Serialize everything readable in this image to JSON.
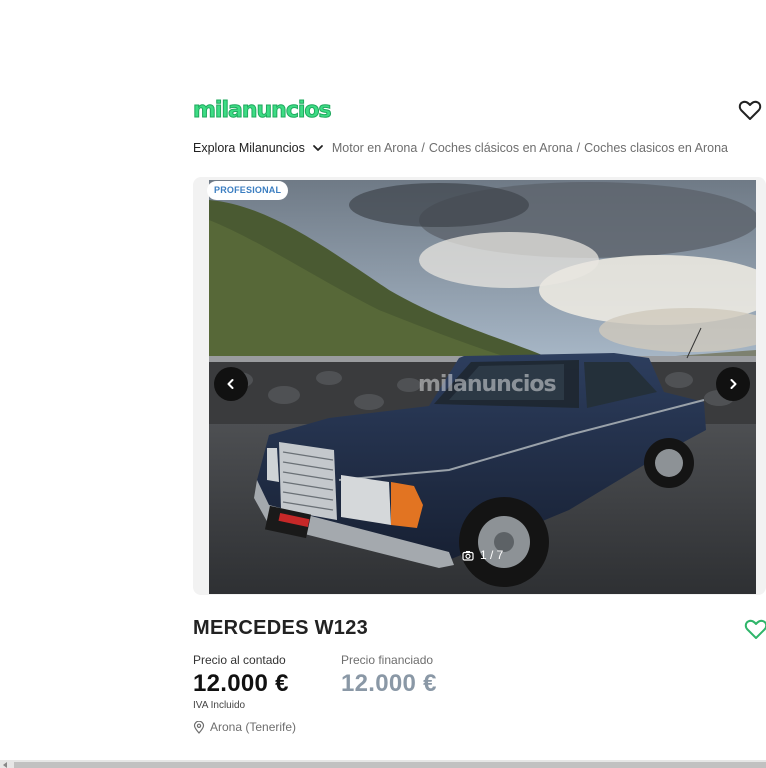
{
  "header": {
    "logo_text": "milanuncios",
    "favorite_icon": "heart-outline-icon"
  },
  "breadcrumb": {
    "explore_label": "Explora Milanuncios",
    "items": [
      "Motor en Arona",
      "Coches clásicos en Arona",
      "Coches clasicos en Arona"
    ],
    "separator": "/"
  },
  "gallery": {
    "badge": "PROFESIONAL",
    "watermark": "milanuncios",
    "counter": "1 / 7",
    "prev_icon": "chevron-left-icon",
    "next_icon": "chevron-right-icon",
    "camera_icon": "camera-icon"
  },
  "listing": {
    "title": "MERCEDES W123",
    "cash_price_label": "Precio al contado",
    "cash_price": "12.000 €",
    "tax_note": "IVA Incluido",
    "financed_price_label": "Precio financiado",
    "financed_price": "12.000 €",
    "location": "Arona (Tenerife)"
  },
  "colors": {
    "brand_green": "#3ddc84",
    "badge_blue": "#3b7ec1",
    "financed_price": "#8a98a6"
  }
}
